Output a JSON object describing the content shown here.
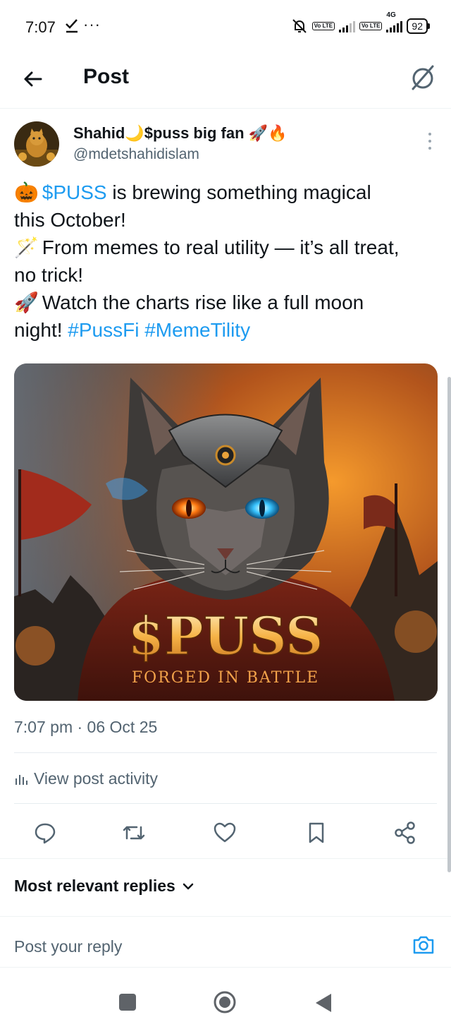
{
  "status_bar": {
    "time": "7:07",
    "overflow": "···",
    "volte1": "Vo LTE",
    "volte2": "Vo LTE",
    "net": "4G",
    "battery": "92"
  },
  "header": {
    "title": "Post"
  },
  "post": {
    "author_name": "Shahid🌙$puss big fan 🚀🔥",
    "author_handle": "@mdetshahidislam",
    "text": {
      "l1_emoji": "🎃",
      "l1_cashtag": "$PUSS",
      "l1_rest": " is brewing something magical",
      "l2": "this October!",
      "l3_emoji": "🪄",
      "l3_rest": " From memes to real utility — it’s all treat,",
      "l4": "no trick!",
      "l5_emoji": "🚀",
      "l5_rest": " Watch the charts rise like a full moon",
      "l6_start": "night! ",
      "hashtag1": "#PussFi",
      "hashtag2": "#MemeTility"
    },
    "image": {
      "brand": "$PUSS",
      "tagline": "FORGED IN BATTLE"
    },
    "timestamp": "7:07 pm · 06 Oct 25",
    "activity_label": "View post activity"
  },
  "replies": {
    "sort_label": "Most relevant replies",
    "input_placeholder": "Post your reply"
  },
  "colors": {
    "accent": "#1d9bf0",
    "text": "#0f1419",
    "muted": "#536471"
  },
  "icons": {
    "back": "arrow-left-icon",
    "grok": "grok-icon",
    "reply": "reply-icon",
    "repost": "repost-icon",
    "like": "heart-icon",
    "bookmark": "bookmark-icon",
    "share": "share-icon",
    "camera": "camera-icon",
    "activity": "bar-chart-icon",
    "sort": "chevron-down-icon"
  }
}
